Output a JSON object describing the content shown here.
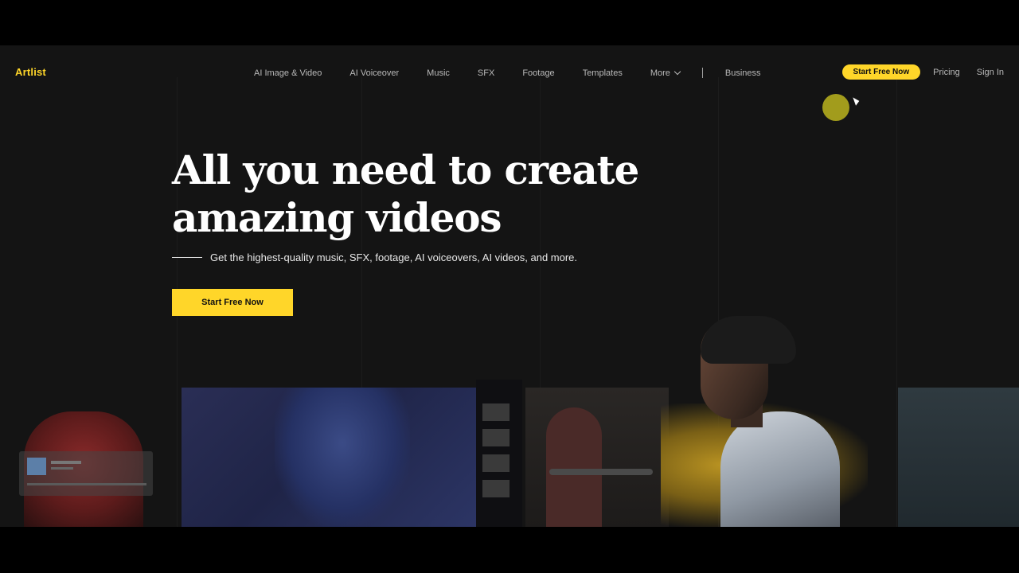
{
  "brand": {
    "logo": "Artlist",
    "accent_color": "#ffd629"
  },
  "nav": {
    "links": [
      "AI Image & Video",
      "AI Voiceover",
      "Music",
      "SFX",
      "Footage",
      "Templates"
    ],
    "more_label": "More",
    "business_label": "Business",
    "start_free_label": "Start Free Now",
    "pricing_label": "Pricing",
    "sign_in_label": "Sign In"
  },
  "hero": {
    "title_line1": "All you need to create",
    "title_line2": "amazing videos",
    "subtitle": "Get the highest-quality music, SFX, footage, AI voiceovers, AI videos, and more.",
    "cta_label": "Start Free Now"
  },
  "icons": [
    "chevron-down-icon",
    "cursor-icon"
  ]
}
